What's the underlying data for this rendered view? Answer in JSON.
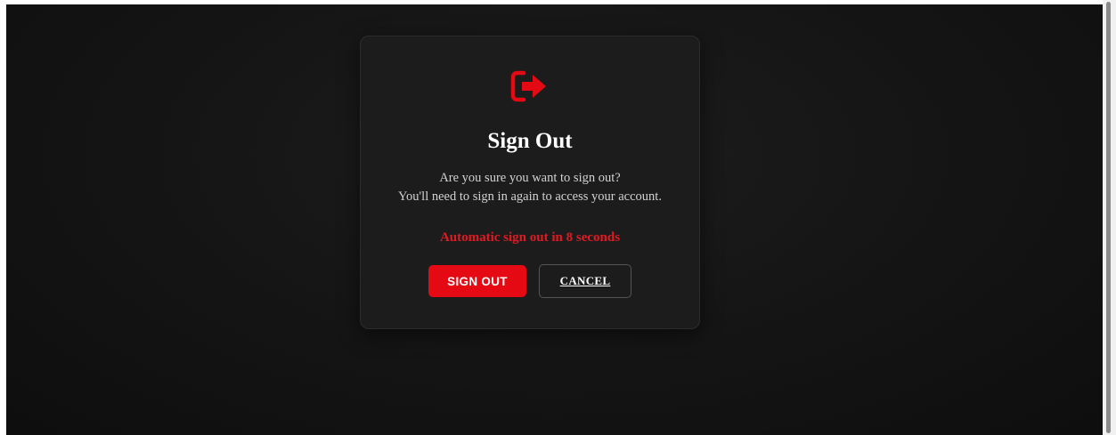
{
  "colors": {
    "accent": "#e50914",
    "countdown": "#e11a22",
    "background": "#141414",
    "dialog": "#1c1c1c"
  },
  "dialog": {
    "icon": "sign-out-icon",
    "title": "Sign Out",
    "message_line1": "Are you sure you want to sign out?",
    "message_line2": "You'll need to sign in again to access your account.",
    "countdown_text": "Automatic sign out in 8 seconds",
    "sign_out_label": "SIGN OUT",
    "cancel_label": "CANCEL"
  }
}
